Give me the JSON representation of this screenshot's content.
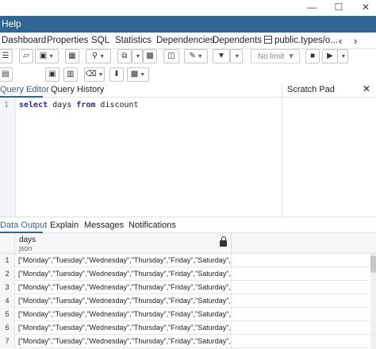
{
  "menubar": {
    "help_label": "Help"
  },
  "tabs": [
    {
      "label": "Dashboard"
    },
    {
      "label": "Properties"
    },
    {
      "label": "SQL"
    },
    {
      "label": "Statistics"
    },
    {
      "label": "Dependencies"
    },
    {
      "label": "Dependents"
    },
    {
      "label": "public.types/o..."
    }
  ],
  "toolbar": {
    "limit_value": "No limit"
  },
  "editor": {
    "tabs": [
      {
        "label": "Query Editor"
      },
      {
        "label": "Query History"
      }
    ],
    "scratch_pad_label": "Scratch Pad",
    "line_number": "1",
    "sql": {
      "kw1": "select",
      "id1": "days",
      "kw2": "from",
      "id2": "discount"
    }
  },
  "results": {
    "tabs": [
      {
        "label": "Data Output"
      },
      {
        "label": "Explain"
      },
      {
        "label": "Messages"
      },
      {
        "label": "Notifications"
      }
    ],
    "column": {
      "name": "days",
      "type": "json"
    },
    "rows": [
      {
        "n": "1",
        "value": "[\"Monday\",\"Tuesday\",\"Wednesday\",\"Thursday\",\"Friday\",\"Saturday\",\"Sunday\"]"
      },
      {
        "n": "2",
        "value": "[\"Monday\",\"Tuesday\",\"Wednesday\",\"Thursday\",\"Friday\",\"Saturday\",\"Sunday\"]"
      },
      {
        "n": "3",
        "value": "[\"Monday\",\"Tuesday\",\"Wednesday\",\"Thursday\",\"Friday\",\"Saturday\",\"Sunday\"]"
      },
      {
        "n": "4",
        "value": "[\"Monday\",\"Tuesday\",\"Wednesday\",\"Thursday\",\"Friday\",\"Saturday\",\"Sunday\"]"
      },
      {
        "n": "5",
        "value": "[\"Monday\",\"Tuesday\",\"Wednesday\",\"Thursday\",\"Friday\",\"Saturday\",\"Sunday\"]"
      },
      {
        "n": "6",
        "value": "[\"Monday\",\"Tuesday\",\"Wednesday\",\"Thursday\",\"Friday\",\"Saturday\",\"Sunday\"]"
      },
      {
        "n": "7",
        "value": "[\"Monday\",\"Tuesday\",\"Wednesday\",\"Thursday\",\"Friday\",\"Saturday\",\"Sunday\"]"
      }
    ]
  },
  "colors": {
    "menubar_bg": "#326690",
    "accent": "#326690"
  }
}
